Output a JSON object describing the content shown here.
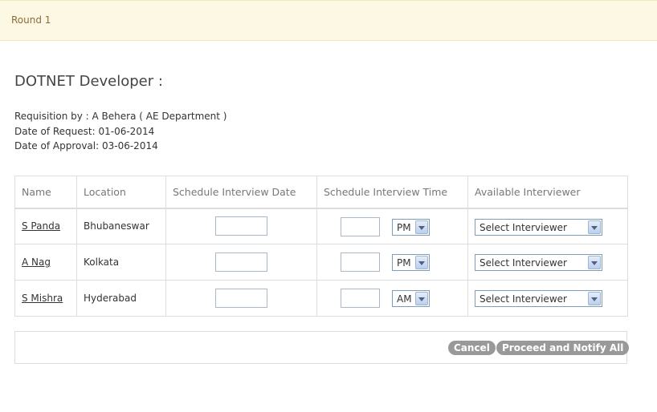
{
  "round": {
    "title": "Round 1"
  },
  "page": {
    "title": "DOTNET Developer :"
  },
  "meta": {
    "requisition": "Requisition by : A Behera ( AE Department )",
    "request_date": "Date of Request: 01-06-2014",
    "approval_date": "Date of Approval: 03-06-2014"
  },
  "table": {
    "headers": [
      "Name",
      "Location",
      "Schedule Interview Date",
      "Schedule Interview Time",
      "Available Interviewer"
    ],
    "rows": [
      {
        "name": "S Panda",
        "location": "Bhubaneswar",
        "date": "",
        "time": "",
        "ampm": "PM",
        "interviewer": "Select Interviewer"
      },
      {
        "name": "A Nag",
        "location": "Kolkata",
        "date": "",
        "time": "",
        "ampm": "PM",
        "interviewer": "Select Interviewer"
      },
      {
        "name": "S Mishra",
        "location": "Hyderabad",
        "date": "",
        "time": "",
        "ampm": "AM",
        "interviewer": "Select Interviewer"
      }
    ]
  },
  "actions": {
    "cancel_label": "Cancel",
    "proceed_label": "Proceed and Notify All"
  }
}
